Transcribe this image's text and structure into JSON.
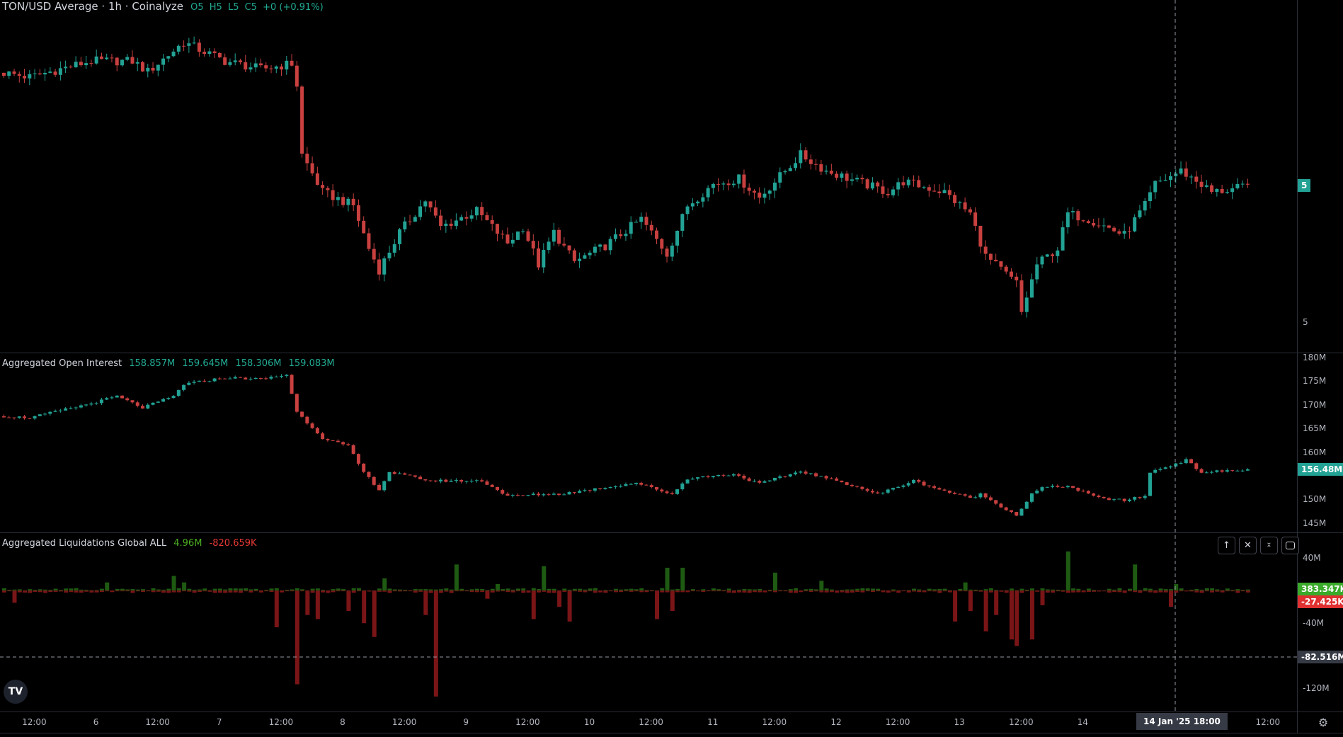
{
  "header": {
    "title": "TON/USD Average · 1h · Coinalyze",
    "ohlc": {
      "o": "O5",
      "h": "H5",
      "l": "L5",
      "c": "C5",
      "change": "+0 (+0.91%)"
    }
  },
  "oi_legend": {
    "title": "Aggregated Open Interest",
    "values": [
      "158.857M",
      "159.645M",
      "158.306M",
      "159.083M"
    ]
  },
  "liq_legend": {
    "title": "Aggregated Liquidations Global ALL",
    "shorts": "4.96M",
    "longs": "-820.659K"
  },
  "price_axis": {
    "labels": [
      "5"
    ],
    "last_price_badge": "5"
  },
  "oi_axis": {
    "labels": [
      "180M",
      "175M",
      "170M",
      "165M",
      "160M",
      "150M",
      "145M"
    ],
    "last_badge": "156.48M"
  },
  "liq_axis": {
    "labels": [
      "40M",
      "-40M",
      "-120M"
    ],
    "short_badge": "383.347K",
    "long_badge": "-27.425K",
    "crosshair_badge": "-82.516M"
  },
  "time_axis": {
    "labels": [
      "12:00",
      "6",
      "12:00",
      "7",
      "12:00",
      "8",
      "12:00",
      "9",
      "12:00",
      "10",
      "12:00",
      "11",
      "12:00",
      "12",
      "12:00",
      "13",
      "12:00",
      "14",
      "12:00"
    ],
    "crosshair_label": "14 Jan '25   18:00"
  },
  "pane_buttons": [
    "move-up",
    "close",
    "collapse",
    "maximize"
  ],
  "colors": {
    "up": "#22a294",
    "down": "#c8403f",
    "short_liq": "#1e5a12",
    "long_liq": "#7a1517",
    "badge_green": "#3aaa2a",
    "badge_red": "#e03030",
    "badge_grey": "#363a45"
  },
  "chart_data": [
    {
      "type": "candlestick",
      "title": "TON/USD Average 1h",
      "x_unit": "hours since first candle (~5 Jan 05:00)",
      "ylim": [
        4.661,
        5.978
      ],
      "keypoints_close": [
        [
          0,
          5.706
        ],
        [
          5,
          5.69
        ],
        [
          17,
          5.75
        ],
        [
          25,
          5.75
        ],
        [
          28,
          5.71
        ],
        [
          35,
          5.82
        ],
        [
          43,
          5.75
        ],
        [
          50,
          5.72
        ],
        [
          56,
          5.74
        ],
        [
          57,
          5.66
        ],
        [
          58,
          5.4
        ],
        [
          62,
          5.26
        ],
        [
          68,
          5.21
        ],
        [
          71,
          5.05
        ],
        [
          73,
          4.97
        ],
        [
          77,
          5.11
        ],
        [
          82,
          5.23
        ],
        [
          85,
          5.13
        ],
        [
          92,
          5.19
        ],
        [
          98,
          5.07
        ],
        [
          101,
          5.13
        ],
        [
          104,
          4.99
        ],
        [
          107,
          5.11
        ],
        [
          111,
          5.0
        ],
        [
          117,
          5.06
        ],
        [
          124,
          5.16
        ],
        [
          129,
          5.03
        ],
        [
          133,
          5.21
        ],
        [
          138,
          5.29
        ],
        [
          143,
          5.31
        ],
        [
          147,
          5.24
        ],
        [
          155,
          5.4
        ],
        [
          160,
          5.34
        ],
        [
          172,
          5.26
        ],
        [
          175,
          5.3
        ],
        [
          183,
          5.26
        ],
        [
          188,
          5.18
        ],
        [
          191,
          5.02
        ],
        [
          197,
          4.92
        ],
        [
          198,
          4.81
        ],
        [
          201,
          4.99
        ],
        [
          205,
          5.05
        ],
        [
          207,
          5.18
        ],
        [
          211,
          5.16
        ],
        [
          218,
          5.1
        ],
        [
          222,
          5.21
        ],
        [
          224,
          5.29
        ],
        [
          229,
          5.34
        ],
        [
          233,
          5.29
        ],
        [
          235,
          5.26
        ],
        [
          242,
          5.28
        ]
      ]
    },
    {
      "type": "candlestick",
      "title": "Aggregated Open Interest",
      "unit": "M USD",
      "ylim": [
        143.4,
        180.9
      ],
      "keypoints_close": [
        [
          0,
          167.7
        ],
        [
          5,
          167.4
        ],
        [
          17,
          170.4
        ],
        [
          22,
          171.9
        ],
        [
          27,
          169.5
        ],
        [
          33,
          171.9
        ],
        [
          35,
          174.4
        ],
        [
          43,
          175.8
        ],
        [
          50,
          175.5
        ],
        [
          55,
          176.4
        ],
        [
          57,
          168.6
        ],
        [
          62,
          163.2
        ],
        [
          67,
          161.4
        ],
        [
          70,
          156
        ],
        [
          73,
          152.4
        ],
        [
          75,
          156
        ],
        [
          83,
          154.2
        ],
        [
          93,
          154.2
        ],
        [
          98,
          151
        ],
        [
          105,
          151.4
        ],
        [
          108,
          151.4
        ],
        [
          117,
          152.8
        ],
        [
          123,
          153.8
        ],
        [
          130,
          151.4
        ],
        [
          133,
          154.7
        ],
        [
          142,
          155.6
        ],
        [
          147,
          153.6
        ],
        [
          155,
          156.2
        ],
        [
          165,
          153.3
        ],
        [
          170,
          151.4
        ],
        [
          177,
          154.2
        ],
        [
          182,
          152.4
        ],
        [
          188,
          150.6
        ],
        [
          190,
          151.4
        ],
        [
          197,
          147
        ],
        [
          200,
          151.4
        ],
        [
          202,
          152.8
        ],
        [
          207,
          153.1
        ],
        [
          213,
          150.6
        ],
        [
          218,
          150.1
        ],
        [
          222,
          151
        ],
        [
          223,
          156
        ],
        [
          228,
          157.8
        ],
        [
          230,
          158.5
        ],
        [
          233,
          156
        ],
        [
          242,
          156.48
        ]
      ]
    },
    {
      "type": "bar",
      "title": "Aggregated Liquidations Global ALL",
      "unit": "M USD",
      "ylim": [
        -148.4,
        70.5
      ],
      "crosshair_value": -82.516,
      "long_spikes": [
        [
          2,
          -15
        ],
        [
          53,
          -45
        ],
        [
          57,
          -115
        ],
        [
          59,
          -30
        ],
        [
          61,
          -35
        ],
        [
          67,
          -25
        ],
        [
          70,
          -40
        ],
        [
          72,
          -57
        ],
        [
          82,
          -30
        ],
        [
          84,
          -130
        ],
        [
          94,
          -10
        ],
        [
          103,
          -35
        ],
        [
          108,
          -20
        ],
        [
          110,
          -38
        ],
        [
          127,
          -35
        ],
        [
          130,
          -25
        ],
        [
          185,
          -38
        ],
        [
          188,
          -25
        ],
        [
          191,
          -50
        ],
        [
          193,
          -30
        ],
        [
          196,
          -60
        ],
        [
          197,
          -68
        ],
        [
          200,
          -60
        ],
        [
          202,
          -18
        ],
        [
          227,
          -20
        ]
      ],
      "short_spikes": [
        [
          20,
          10
        ],
        [
          33,
          18
        ],
        [
          35,
          10
        ],
        [
          74,
          15
        ],
        [
          88,
          32
        ],
        [
          96,
          8
        ],
        [
          105,
          30
        ],
        [
          129,
          28
        ],
        [
          132,
          28
        ],
        [
          150,
          22
        ],
        [
          159,
          12
        ],
        [
          187,
          10
        ],
        [
          207,
          48
        ],
        [
          220,
          32
        ],
        [
          228,
          8
        ]
      ]
    }
  ]
}
